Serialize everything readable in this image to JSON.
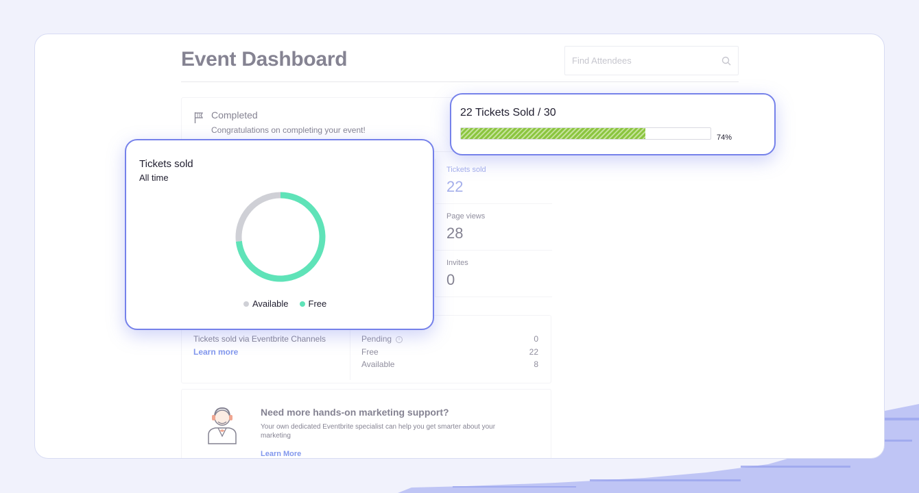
{
  "dashboard": {
    "title": "Event Dashboard",
    "search_placeholder": "Find Attendees",
    "status": {
      "title": "Completed",
      "message": "Congratulations on completing your event!"
    },
    "stats": [
      {
        "label": "Tickets sold",
        "value": "22"
      },
      {
        "label": "Page views",
        "value": "28"
      },
      {
        "label": "Invites",
        "value": "0"
      }
    ],
    "sales": {
      "channel_label": "Tickets sold via Eventbrite Channels",
      "learn_more": "Learn more",
      "rows": [
        {
          "label": "Pending",
          "value": "0"
        },
        {
          "label": "Free",
          "value": "22"
        },
        {
          "label": "Available",
          "value": "8"
        }
      ]
    },
    "marketing": {
      "title": "Need more hands-on marketing support?",
      "description": "Your own dedicated Eventbrite specialist can help you get smarter about your marketing",
      "learn_more": "Learn More"
    }
  },
  "tickets_card": {
    "title": "Tickets sold",
    "subtitle": "All time",
    "legend": [
      {
        "label": "Available",
        "color": "#cfd0d6"
      },
      {
        "label": "Free",
        "color": "#5fe3b8"
      }
    ]
  },
  "progress_card": {
    "title": "22 Tickets Sold / 30",
    "percent_label": "74%",
    "progress": 0.74
  },
  "chart_data": {
    "type": "pie",
    "title": "Tickets sold",
    "subtitle": "All time",
    "categories": [
      "Available",
      "Free"
    ],
    "values": [
      8,
      22
    ],
    "colors": [
      "#cfd0d6",
      "#5fe3b8"
    ]
  }
}
